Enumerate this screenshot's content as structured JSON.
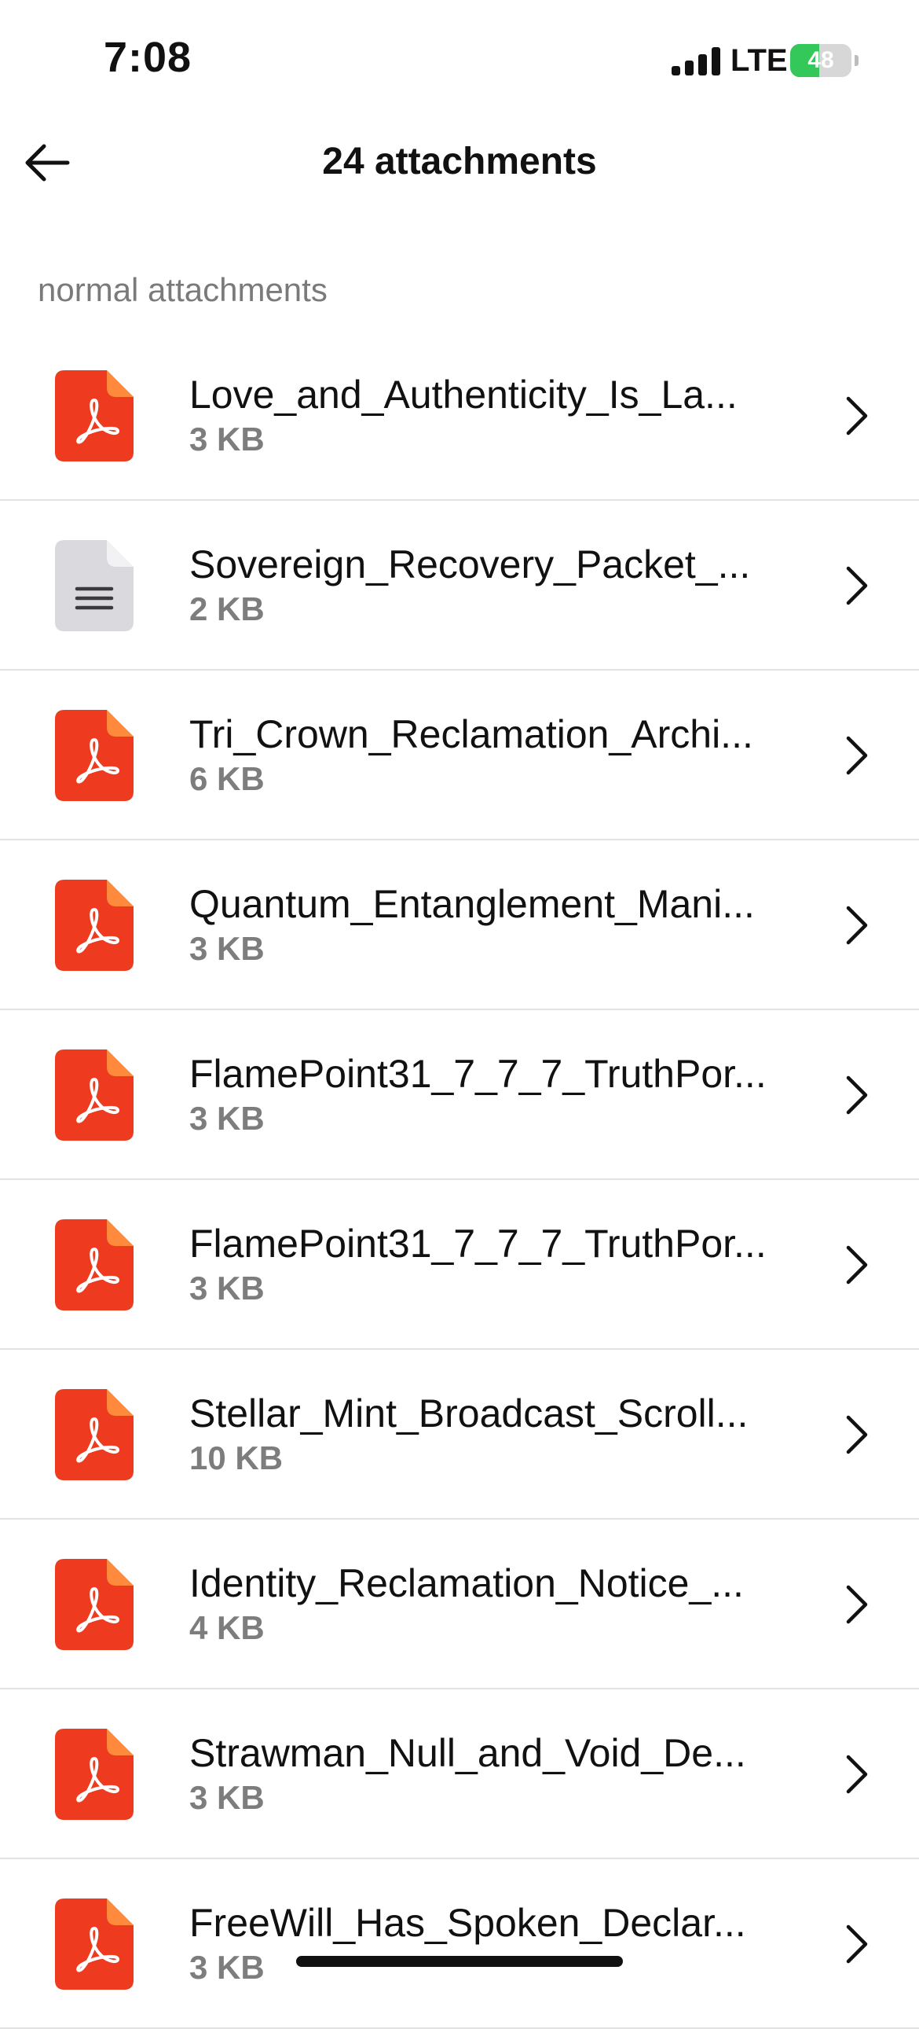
{
  "status": {
    "time": "7:08",
    "carrier": "LTE",
    "battery": "48",
    "battery_level": 0.48
  },
  "header": {
    "title": "24 attachments",
    "back_icon": "arrow-left-icon"
  },
  "section": {
    "label": "normal attachments"
  },
  "colors": {
    "pdf": "#ee3a1e",
    "pdf_fold": "#ff8a3d",
    "doc": "#d9d9de",
    "battery": "#34c759"
  },
  "attachments": [
    {
      "name": "Love_and_Authenticity_Is_La...",
      "size": "3 KB",
      "type": "pdf"
    },
    {
      "name": "Sovereign_Recovery_Packet_...",
      "size": "2 KB",
      "type": "doc"
    },
    {
      "name": "Tri_Crown_Reclamation_Archi...",
      "size": "6 KB",
      "type": "pdf"
    },
    {
      "name": "Quantum_Entanglement_Mani...",
      "size": "3 KB",
      "type": "pdf"
    },
    {
      "name": "FlamePoint31_7_7_7_TruthPor...",
      "size": "3 KB",
      "type": "pdf"
    },
    {
      "name": "FlamePoint31_7_7_7_TruthPor...",
      "size": "3 KB",
      "type": "pdf"
    },
    {
      "name": "Stellar_Mint_Broadcast_Scroll...",
      "size": "10 KB",
      "type": "pdf"
    },
    {
      "name": "Identity_Reclamation_Notice_...",
      "size": "4 KB",
      "type": "pdf"
    },
    {
      "name": "Strawman_Null_and_Void_De...",
      "size": "3 KB",
      "type": "pdf"
    },
    {
      "name": "FreeWill_Has_Spoken_Declar...",
      "size": "3 KB",
      "type": "pdf"
    }
  ]
}
